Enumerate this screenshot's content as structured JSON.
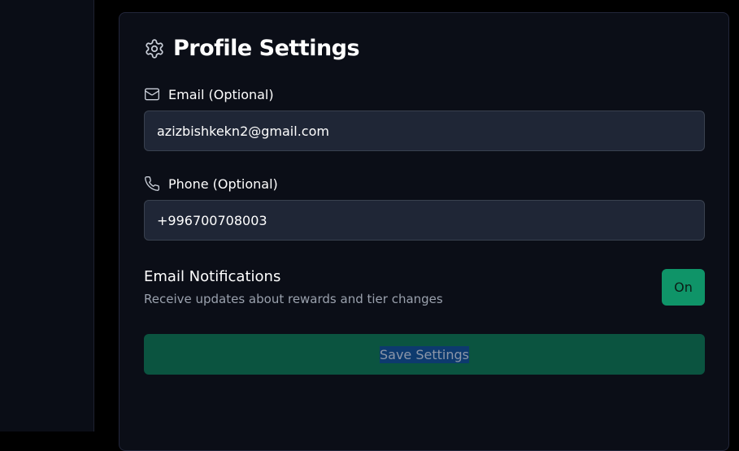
{
  "profile": {
    "title": "Profile Settings",
    "title_icon": "gear-icon"
  },
  "email": {
    "label": "Email (Optional)",
    "icon": "mail-icon",
    "value": "azizbishkekn2@gmail.com"
  },
  "phone": {
    "label": "Phone (Optional)",
    "icon": "phone-icon",
    "value": "+996700708003"
  },
  "notifications": {
    "title": "Email Notifications",
    "description": "Receive updates about rewards and tier changes",
    "toggle_label": "On"
  },
  "actions": {
    "save_label": "Save Settings"
  },
  "colors": {
    "page_background": "#000000",
    "card_background": "#0b0e17",
    "input_background": "#1f2636",
    "toggle_on": "#0f9468",
    "save_button": "#0b5440"
  }
}
